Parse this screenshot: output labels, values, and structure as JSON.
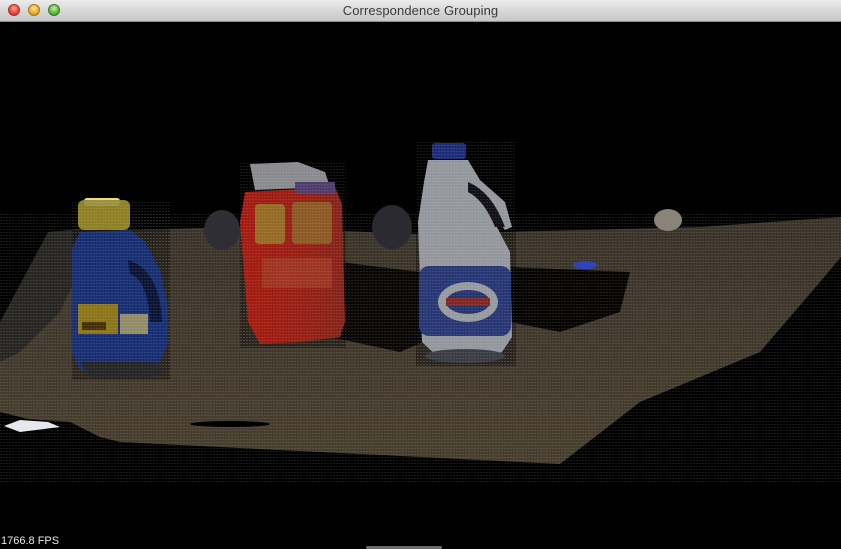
{
  "window": {
    "title": "Correspondence Grouping",
    "controls": {
      "close": "close-icon",
      "minimize": "minimize-icon",
      "zoom": "zoom-icon"
    }
  },
  "viewer": {
    "fps_label": "1766.8 FPS",
    "background_color": "#000000",
    "objects": [
      {
        "name": "detergent-bottle",
        "color": "#2a4fb8",
        "cap_color": "#e3cf3c"
      },
      {
        "name": "milk-carton",
        "color": "#d8dde6",
        "highlight_color": "#ff2a1a"
      },
      {
        "name": "bleach-bottle",
        "color": "#e6ecf4",
        "cap_color": "#2a3fa8"
      },
      {
        "name": "table-surface",
        "color": "#5e5140"
      }
    ]
  }
}
